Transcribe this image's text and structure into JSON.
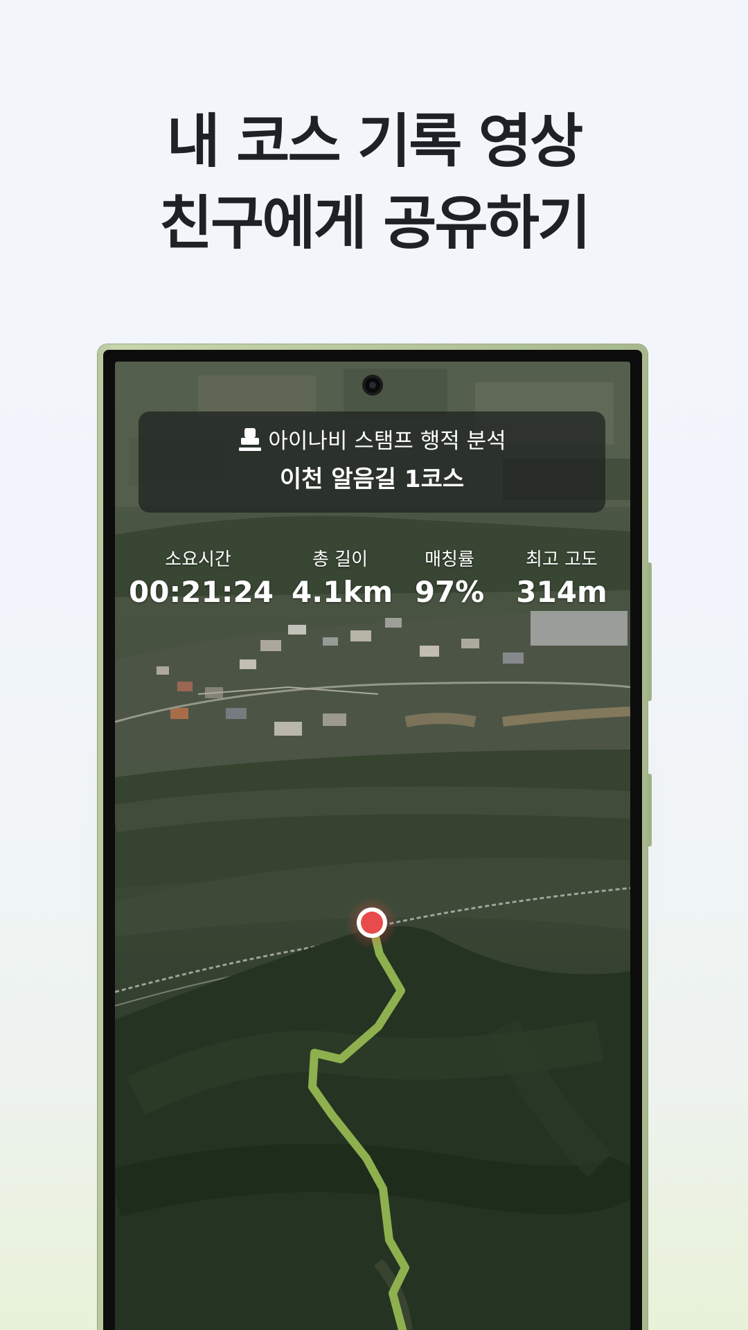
{
  "headline": {
    "line1": "내 코스 기록 영상",
    "line2": "친구에게 공유하기"
  },
  "card": {
    "stamp_icon": "stamp-icon",
    "subtitle": "아이나비 스탬프 행적 분석",
    "course_name": "이천 알음길 1코스"
  },
  "stats": [
    {
      "label": "소요시간",
      "value": "00:21:24"
    },
    {
      "label": "총 길이",
      "value": "4.1km"
    },
    {
      "label": "매칭률",
      "value": "97%"
    },
    {
      "label": "최고 고도",
      "value": "314m"
    }
  ],
  "colors": {
    "route": "#8fb04e",
    "current_position": "#e84b4b",
    "headline_text": "#202124",
    "phone_frame": "#b6c69d"
  }
}
